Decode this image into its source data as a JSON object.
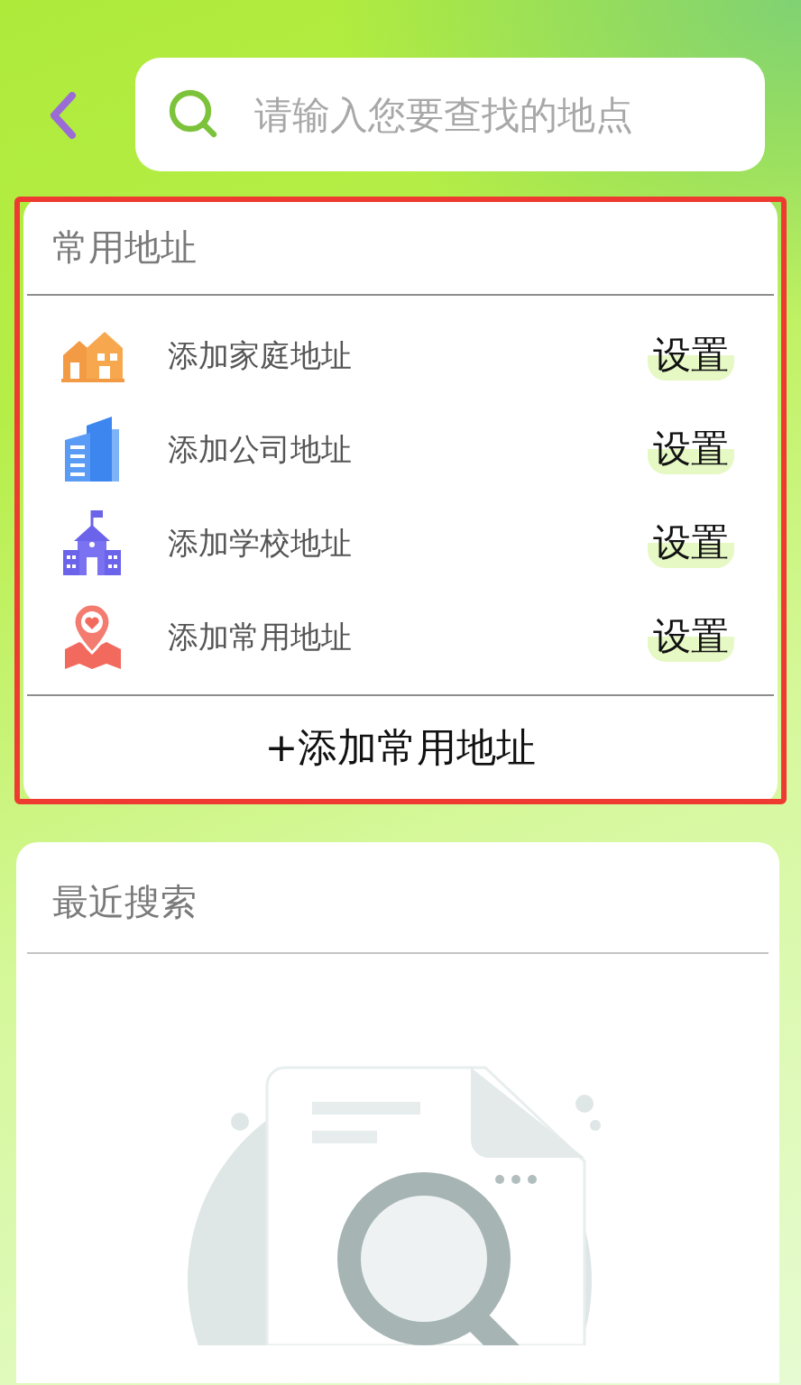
{
  "search": {
    "placeholder": "请输入您要查找的地点"
  },
  "common_addresses": {
    "title": "常用地址",
    "items": [
      {
        "kind": "home",
        "label": "添加家庭地址",
        "action": "设置"
      },
      {
        "kind": "office",
        "label": "添加公司地址",
        "action": "设置"
      },
      {
        "kind": "school",
        "label": "添加学校地址",
        "action": "设置"
      },
      {
        "kind": "favorite",
        "label": "添加常用地址",
        "action": "设置"
      }
    ],
    "add_button": "+添加常用地址"
  },
  "recent_searches": {
    "title": "最近搜索"
  }
}
